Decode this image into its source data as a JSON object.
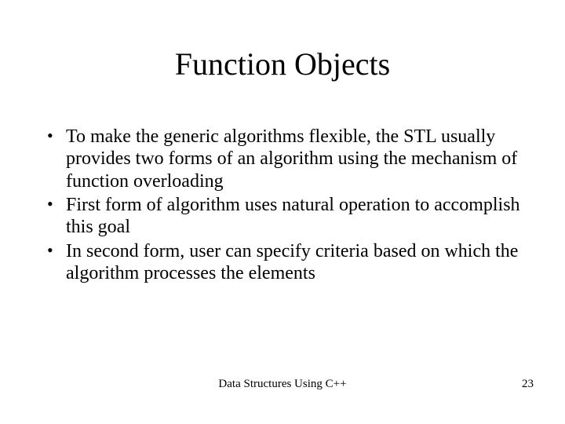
{
  "title": "Function Objects",
  "bullets": [
    "To make the generic algorithms flexible, the STL usually provides two forms of an algorithm using the mechanism of function overloading",
    "First form of algorithm uses natural operation to accomplish this goal",
    "In second form, user can specify criteria based on which the algorithm processes the elements"
  ],
  "footer": {
    "center": "Data Structures Using C++",
    "page": "23"
  }
}
